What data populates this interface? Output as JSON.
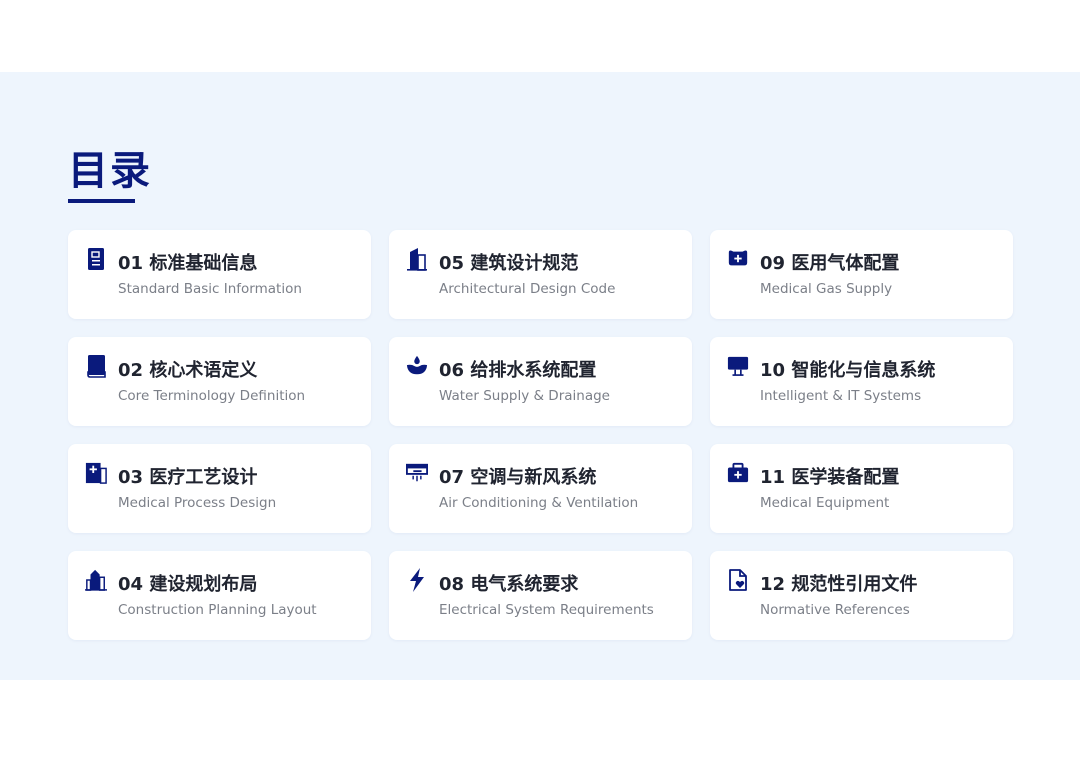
{
  "heading": "目录",
  "accent_color": "#0a1a7c",
  "items": [
    {
      "title": "01 标准基础信息",
      "subtitle": "Standard Basic Information",
      "icon": "document-icon"
    },
    {
      "title": "05 建筑设计规范",
      "subtitle": "Architectural Design Code",
      "icon": "building-icon"
    },
    {
      "title": "09 医用气体配置",
      "subtitle": "Medical Gas Supply",
      "icon": "medical-gas-icon"
    },
    {
      "title": "02 核心术语定义",
      "subtitle": "Core Terminology Definition",
      "icon": "book-icon"
    },
    {
      "title": "06 给排水系统配置",
      "subtitle": "Water Supply & Drainage",
      "icon": "water-drop-icon"
    },
    {
      "title": "10 智能化与信息系统",
      "subtitle": "Intelligent & IT Systems",
      "icon": "monitor-icon"
    },
    {
      "title": "03 医疗工艺设计",
      "subtitle": "Medical Process Design",
      "icon": "medical-plus-icon"
    },
    {
      "title": "07 空调与新风系统",
      "subtitle": "Air Conditioning & Ventilation",
      "icon": "air-conditioner-icon"
    },
    {
      "title": "11 医学装备配置",
      "subtitle": "Medical Equipment",
      "icon": "medical-kit-icon"
    },
    {
      "title": "04 建设规划布局",
      "subtitle": "Construction Planning Layout",
      "icon": "city-buildings-icon"
    },
    {
      "title": "08 电气系统要求",
      "subtitle": "Electrical System Requirements",
      "icon": "lightning-icon"
    },
    {
      "title": "12 规范性引用文件",
      "subtitle": "Normative References",
      "icon": "file-reference-icon"
    }
  ]
}
